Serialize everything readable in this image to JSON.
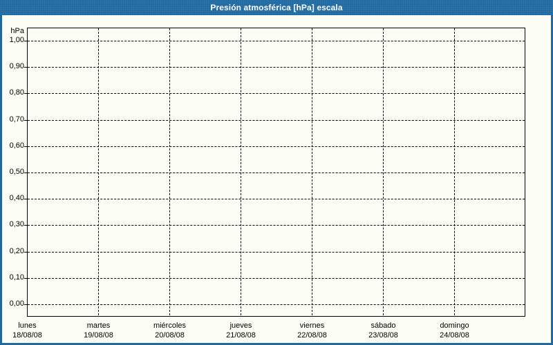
{
  "window": {
    "title": "Presión atmosférica [hPa] escala"
  },
  "chart_data": {
    "type": "line",
    "title": "Presión atmosférica [hPa] escala",
    "grid": "dashed",
    "legend": "none",
    "series": [],
    "y_axis": {
      "unit_label": "hPa",
      "range": [
        0.0,
        1.0
      ],
      "tick_step": 0.1,
      "tick_labels": [
        "1,00",
        "0,90",
        "0,80",
        "0,70",
        "0,60",
        "0,50",
        "0,40",
        "0,30",
        "0,20",
        "0,10",
        "0,00"
      ]
    },
    "x_axis": {
      "categories": [
        {
          "day": "lunes",
          "date": "18/08/08"
        },
        {
          "day": "martes",
          "date": "19/08/08"
        },
        {
          "day": "miércoles",
          "date": "20/08/08"
        },
        {
          "day": "jueves",
          "date": "21/08/08"
        },
        {
          "day": "viernes",
          "date": "22/08/08"
        },
        {
          "day": "sábado",
          "date": "23/08/08"
        },
        {
          "day": "domingo",
          "date": "24/08/08"
        }
      ]
    }
  },
  "colors": {
    "header_bg": "#1f69a2",
    "frame_border": "#1f69a2",
    "body_bg": "#fcfdf5",
    "grid_line": "#000000",
    "label_text": "#000000",
    "title_text": "#ffffff"
  }
}
